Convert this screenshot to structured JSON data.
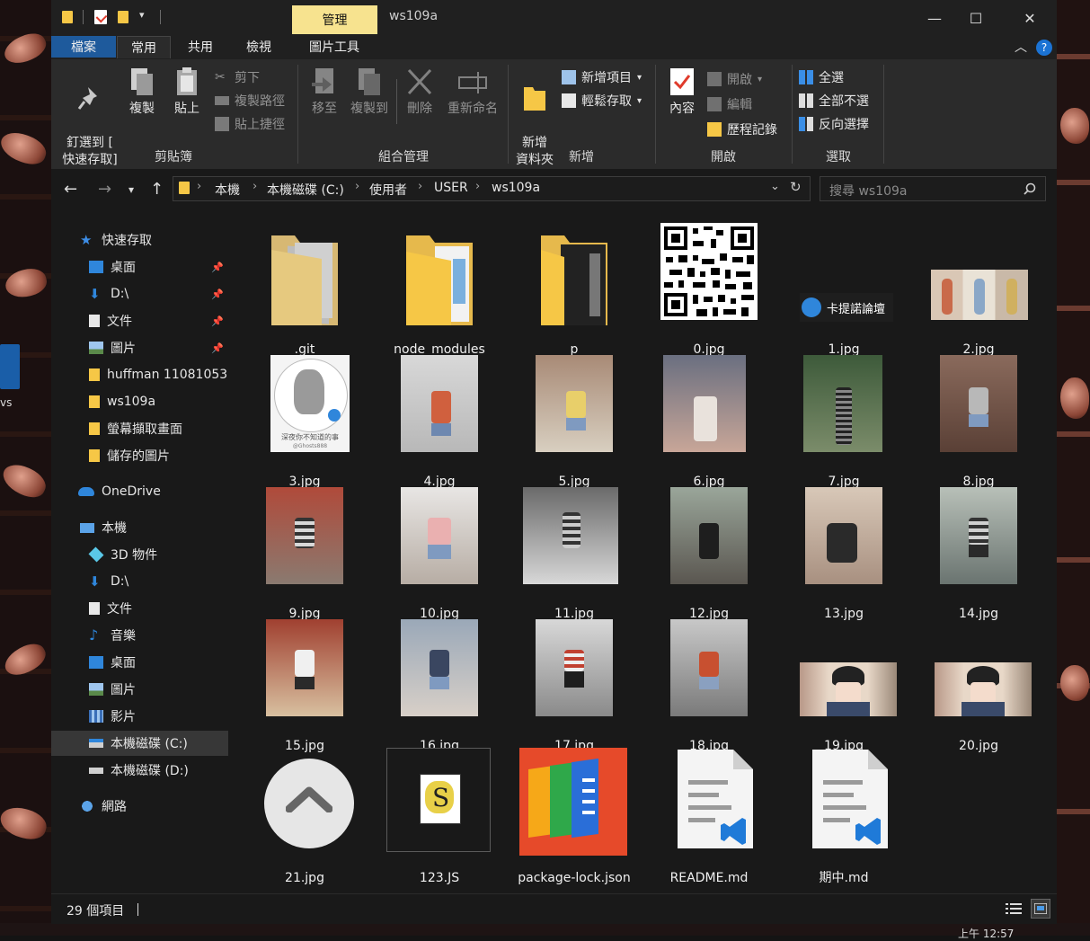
{
  "window": {
    "title": "ws109a",
    "contextual_tab": "管理",
    "controls": [
      "—",
      "☐",
      "✕"
    ]
  },
  "ribbon_tabs": [
    "檔案",
    "常用",
    "共用",
    "檢視",
    "圖片工具"
  ],
  "ribbon": {
    "clipboard": {
      "label": "剪貼簿",
      "pin": "釘選到 [\n快速存取]",
      "copy": "複製",
      "paste": "貼上",
      "cut": "剪下",
      "copy_path": "複製路徑",
      "paste_shortcut": "貼上捷徑"
    },
    "organize": {
      "label": "組合管理",
      "move_to": "移至",
      "copy_to": "複製到",
      "delete": "刪除",
      "rename": "重新命名"
    },
    "new": {
      "label": "新增",
      "new_folder": "新增\n資料夾",
      "new_item": "新增項目",
      "easy_access": "輕鬆存取"
    },
    "open": {
      "label": "開啟",
      "properties": "內容",
      "open": "開啟",
      "edit": "編輯",
      "history": "歷程記錄"
    },
    "select": {
      "label": "選取",
      "select_all": "全選",
      "select_none": "全部不選",
      "invert": "反向選擇"
    }
  },
  "address": {
    "crumbs": [
      "本機",
      "本機磁碟 (C:)",
      "使用者",
      "USER",
      "ws109a"
    ],
    "search_placeholder": "搜尋 ws109a"
  },
  "nav": {
    "quick_access": "快速存取",
    "quick_items": [
      "桌面",
      "D:\\",
      "文件",
      "圖片",
      "huffman 11081053",
      "ws109a",
      "螢幕擷取畫面",
      "儲存的圖片"
    ],
    "onedrive": "OneDrive",
    "this_pc": "本機",
    "pc_items": [
      "3D 物件",
      "D:\\",
      "文件",
      "音樂",
      "桌面",
      "圖片",
      "影片",
      "本機磁碟 (C:)",
      "本機磁碟 (D:)"
    ],
    "network": "網路"
  },
  "files": [
    ".git",
    "node_modules",
    "p",
    "0.jpg",
    "1.jpg",
    "2.jpg",
    "3.jpg",
    "4.jpg",
    "5.jpg",
    "6.jpg",
    "7.jpg",
    "8.jpg",
    "9.jpg",
    "10.jpg",
    "11.jpg",
    "12.jpg",
    "13.jpg",
    "14.jpg",
    "15.jpg",
    "16.jpg",
    "17.jpg",
    "18.jpg",
    "19.jpg",
    "20.jpg",
    "21.jpg",
    "123.JS",
    "package-lock.json",
    "README.md",
    "期中.md"
  ],
  "thumb_text": {
    "forum_badge": "卡提諾論壇",
    "sticker_caption": "深夜你不知道的事",
    "sticker_handle": "@Ghosts888"
  },
  "status": {
    "count": "29 個項目"
  },
  "desktop": {
    "icon_label": "vs",
    "clock": "上午 12:57"
  },
  "colors": {
    "accent": "#1e5a9c",
    "manage_tab": "#f7e38f",
    "folder": "#f6c746"
  }
}
